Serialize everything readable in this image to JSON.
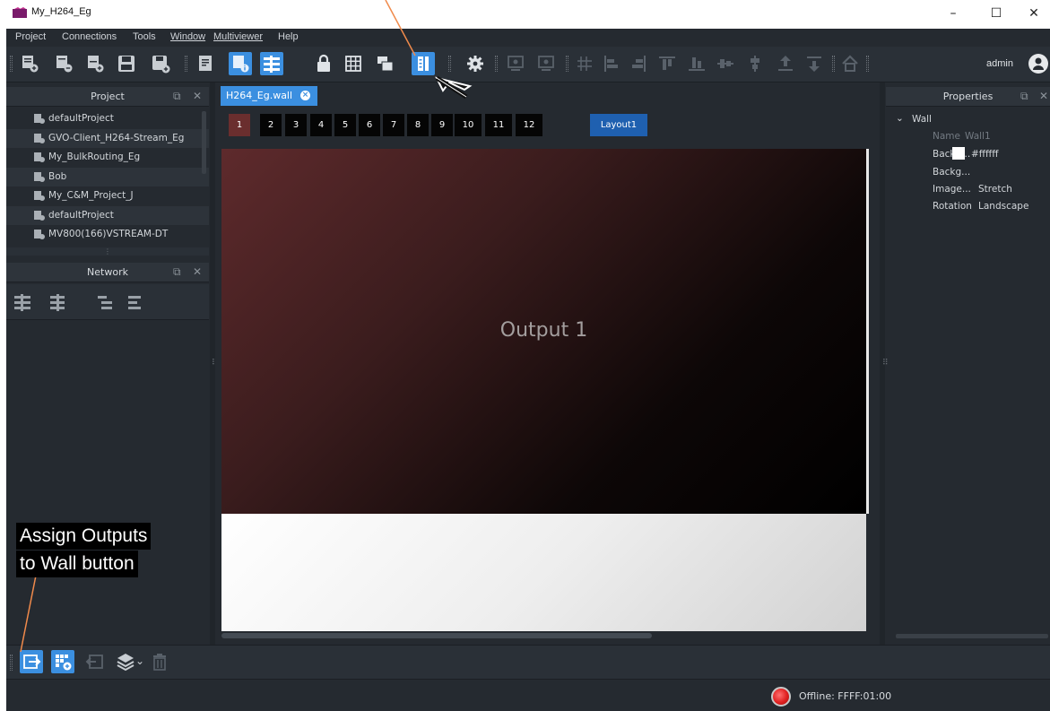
{
  "window": {
    "title": "My_H264_Eg",
    "minimize": "–",
    "maximize": "☐",
    "close": "✕"
  },
  "menu": [
    "Project",
    "Connections",
    "Tools",
    "Window",
    "Multiviewer",
    "Help"
  ],
  "toolbar": {
    "user": "admin"
  },
  "project_panel": {
    "title": "Project",
    "items": [
      "defaultProject",
      "GVO-Client_H264-Stream_Eg",
      "My_BulkRouting_Eg",
      "Bob",
      "My_C&M_Project_J",
      "defaultProject",
      "MV800(166)VSTREAM-DT"
    ]
  },
  "network_panel": {
    "title": "Network"
  },
  "document": {
    "tab_label": "H264_Eg.wall",
    "outputs": [
      "1",
      "2",
      "3",
      "4",
      "5",
      "6",
      "7",
      "8",
      "9",
      "10",
      "11",
      "12"
    ],
    "selected_output": "1",
    "layout_label": "Layout1",
    "canvas_label": "Output 1"
  },
  "properties_panel": {
    "title": "Properties",
    "section": "Wall",
    "rows": [
      {
        "key": "Name",
        "value": "Wall1"
      },
      {
        "key": "Backg...",
        "value": "#ffffff"
      },
      {
        "key": "Backg...",
        "value": ""
      },
      {
        "key": "Image...",
        "value": "Stretch"
      },
      {
        "key": "Rotation",
        "value": "Landscape"
      }
    ]
  },
  "status": {
    "text": "Offline: FFFF:01:00"
  },
  "annotations": {
    "callout_line1": "Assign Outputs",
    "callout_line2": "to Wall button"
  },
  "colors": {
    "accent": "#3b8fe0",
    "selected_output": "#6a2e2e",
    "panel_bg": "#252a30",
    "callout_line": "#f08a4b"
  }
}
